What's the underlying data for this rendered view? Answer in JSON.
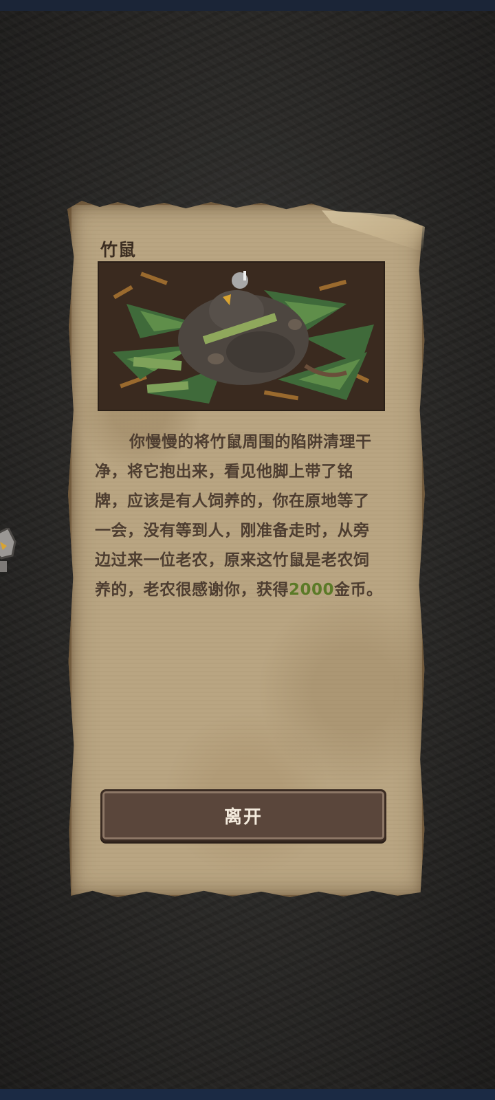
{
  "event": {
    "title": "竹鼠",
    "story_before": "你慢慢的将竹鼠周围的陷阱清理干净，将它抱出来，看见他脚上带了铭牌，应该是有人饲养的，你在原地等了一会，没有等到人，刚准备走时，从旁边过来一位老农，原来这竹鼠是老农饲养的，老农很感谢你，获得",
    "reward_amount": "2000",
    "story_after": "金币。",
    "image_icon": "bamboo-rat-illustration"
  },
  "actions": {
    "leave_label": "离开"
  },
  "colors": {
    "parchment": "#b9a582",
    "text": "#4d3d30",
    "reward": "#5b7a27",
    "button": "#5a463b",
    "background": "#2a2927"
  }
}
